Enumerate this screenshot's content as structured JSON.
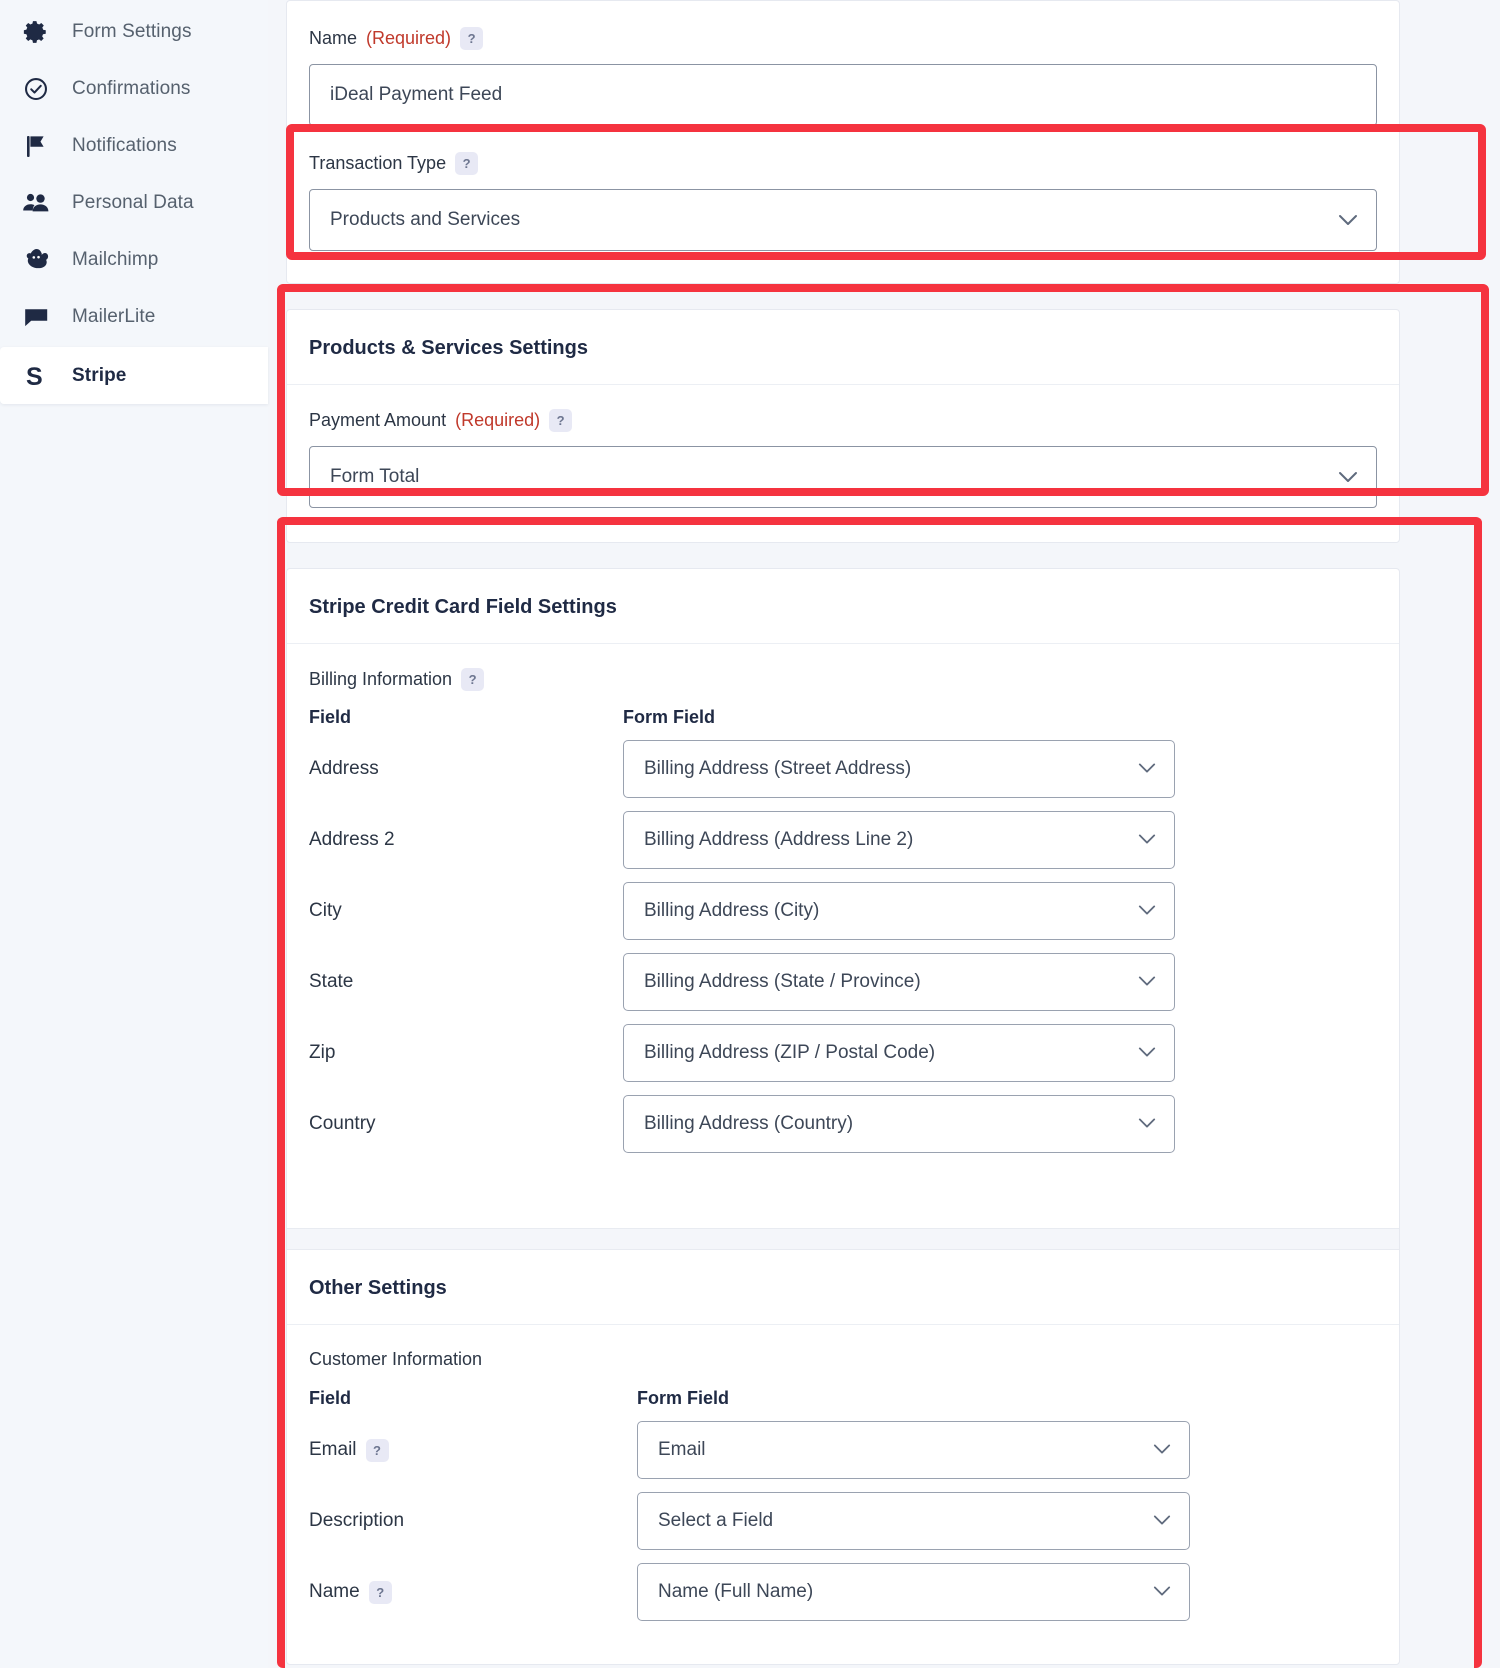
{
  "sidebar": {
    "items": [
      {
        "label": "Form Settings",
        "icon": "gear-icon",
        "active": false
      },
      {
        "label": "Confirmations",
        "icon": "check-circle-icon",
        "active": false
      },
      {
        "label": "Notifications",
        "icon": "flag-icon",
        "active": false
      },
      {
        "label": "Personal Data",
        "icon": "users-icon",
        "active": false
      },
      {
        "label": "Mailchimp",
        "icon": "mailchimp-icon",
        "active": false
      },
      {
        "label": "MailerLite",
        "icon": "chat-bubble-icon",
        "active": false
      },
      {
        "label": "Stripe",
        "icon": "stripe-s-icon",
        "active": true
      }
    ]
  },
  "feed": {
    "name_field": {
      "label": "Name",
      "required_text": "(Required)",
      "help": "?",
      "value": "iDeal Payment Feed"
    },
    "transaction_type": {
      "label": "Transaction Type",
      "help": "?",
      "value": "Products and Services"
    }
  },
  "products_services": {
    "title": "Products & Services Settings",
    "payment_amount": {
      "label": "Payment Amount",
      "required_text": "(Required)",
      "help": "?",
      "value": "Form Total"
    }
  },
  "stripe_card": {
    "title": "Stripe Credit Card Field Settings",
    "billing_information": {
      "label": "Billing Information",
      "help": "?",
      "col_field": "Field",
      "col_form_field": "Form Field",
      "rows": [
        {
          "field": "Address",
          "value": "Billing Address (Street Address)"
        },
        {
          "field": "Address 2",
          "value": "Billing Address (Address Line 2)"
        },
        {
          "field": "City",
          "value": "Billing Address (City)"
        },
        {
          "field": "State",
          "value": "Billing Address (State / Province)"
        },
        {
          "field": "Zip",
          "value": "Billing Address (ZIP / Postal Code)"
        },
        {
          "field": "Country",
          "value": "Billing Address (Country)"
        }
      ]
    }
  },
  "other_settings": {
    "title": "Other Settings",
    "customer_information": {
      "label": "Customer Information",
      "col_field": "Field",
      "col_form_field": "Form Field",
      "rows": [
        {
          "field": "Email",
          "help": "?",
          "value": "Email"
        },
        {
          "field": "Description",
          "help": "",
          "value": "Select a Field"
        },
        {
          "field": "Name",
          "help": "?",
          "value": "Name (Full Name)"
        }
      ]
    }
  },
  "annotations": {
    "highlight_color": "#f5333f",
    "boxes": [
      "transaction-type-highlight",
      "products-services-highlight",
      "stripe-card-settings-highlight"
    ]
  }
}
